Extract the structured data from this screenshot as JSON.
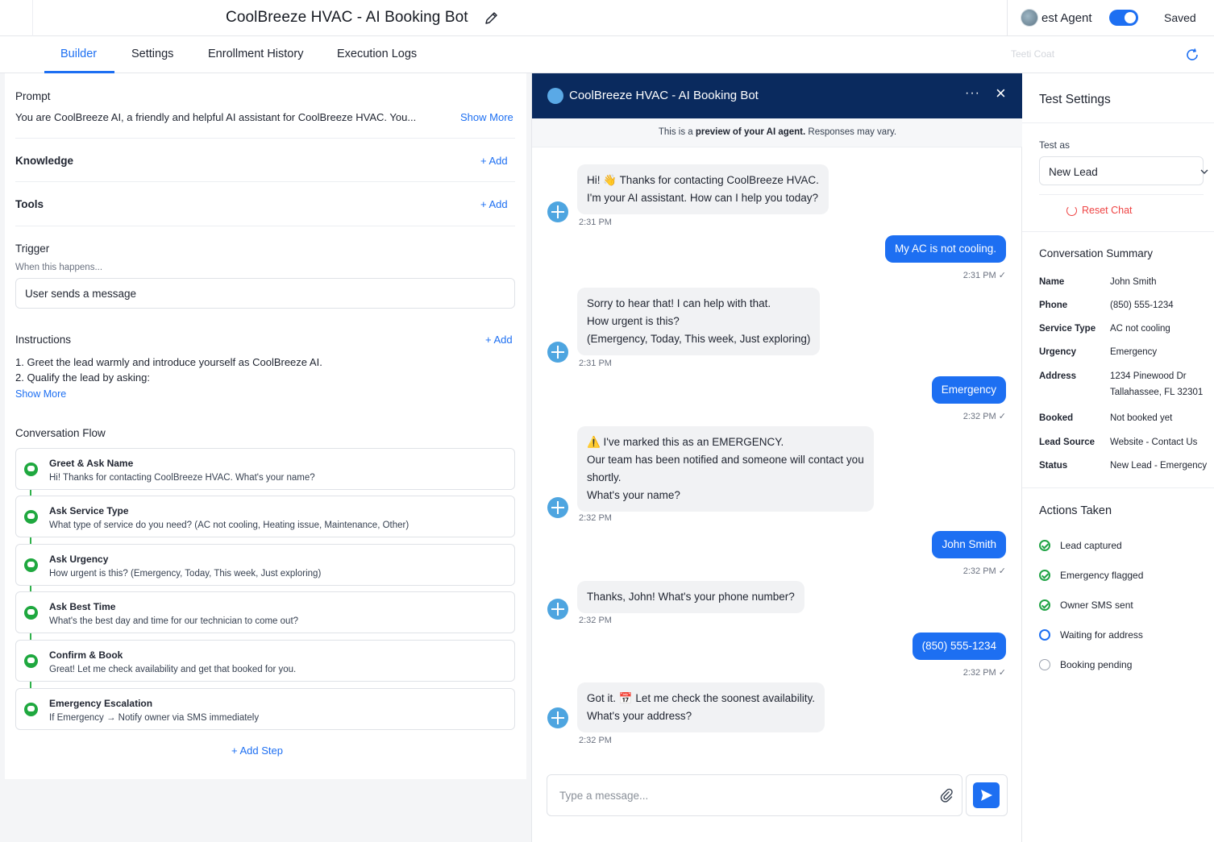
{
  "header": {
    "title": "CoolBreeze HVAC - AI Booking Bot",
    "agent_label": "est Agent",
    "saved": "Saved"
  },
  "tabs": [
    {
      "label": "Builder"
    },
    {
      "label": "Settings"
    },
    {
      "label": "Enrollment History"
    },
    {
      "label": "Execution Logs"
    }
  ],
  "tabbar_ghost": "Teeti Coat",
  "builder": {
    "prompt_label": "Prompt",
    "prompt_text": "You are CoolBreeze AI, a friendly and helpful AI assistant for CoolBreeze HVAC. You...",
    "show_more": "Show More",
    "knowledge_label": "Knowledge",
    "tools_label": "Tools",
    "add": "+ Add",
    "trigger_label": "Trigger",
    "trigger_sub": "When this happens...",
    "trigger_value": "User sends a message",
    "instructions_label": "Instructions",
    "instructions": [
      "1. Greet the lead warmly and introduce yourself as CoolBreeze AI.",
      "2. Qualify the lead by asking:"
    ],
    "instructions_show_more": "Show More",
    "flow_label": "Conversation Flow",
    "steps": [
      {
        "title": "Greet & Ask Name",
        "desc": "Hi! Thanks for contacting CoolBreeze HVAC. What's your name?"
      },
      {
        "title": "Ask Service Type",
        "desc": "What type of service do you need? (AC not cooling, Heating issue, Maintenance, Other)"
      },
      {
        "title": "Ask Urgency",
        "desc": "How urgent is this? (Emergency, Today, This week, Just exploring)"
      },
      {
        "title": "Ask Best Time",
        "desc": "What's the best day and time for our technician to come out?"
      },
      {
        "title": "Confirm & Book",
        "desc": "Great! Let me check availability and get that booked for you."
      },
      {
        "title": "Emergency Escalation",
        "desc": "If Emergency → Notify owner via SMS immediately"
      }
    ],
    "add_step": "+ Add Step"
  },
  "chat": {
    "title": "CoolBreeze HVAC - AI Booking Bot",
    "more": "···",
    "close": "×",
    "preview_pre": "This is a ",
    "preview_bold": "preview of your AI agent.",
    "preview_post": " Responses may vary.",
    "messages": [
      {
        "from": "bot",
        "lines": [
          "Hi! 👋 Thanks for contacting CoolBreeze HVAC.",
          "I'm your AI assistant. How can I help you today?"
        ],
        "time": "2:31 PM"
      },
      {
        "from": "user",
        "text": "My AC is not cooling.",
        "time": "2:31 PM ✓"
      },
      {
        "from": "bot",
        "lines": [
          "Sorry to hear that! I can help with that.",
          "How urgent is this?",
          "(Emergency, Today, This week, Just exploring)"
        ],
        "time": "2:31 PM"
      },
      {
        "from": "user",
        "text": "Emergency",
        "time": "2:32 PM ✓"
      },
      {
        "from": "bot",
        "lines": [
          "⚠️ I've marked this as an EMERGENCY.",
          "Our team has been notified and someone will contact you",
          "shortly.",
          "What's your name?"
        ],
        "time": "2:32 PM"
      },
      {
        "from": "user",
        "text": "John Smith",
        "time": "2:32 PM ✓"
      },
      {
        "from": "bot",
        "lines": [
          "Thanks, John! What's your phone number?"
        ],
        "time": "2:32 PM"
      },
      {
        "from": "user",
        "text": "(850) 555-1234",
        "time": "2:32 PM ✓"
      },
      {
        "from": "bot",
        "lines": [
          "Got it. 📅 Let me check the soonest availability.",
          "What's your address?"
        ],
        "time": "2:32 PM"
      }
    ],
    "input_placeholder": "Type a message..."
  },
  "test_settings": {
    "title": "Test Settings",
    "test_as_label": "Test as",
    "test_as_value": "New Lead",
    "reset_chat": "Reset Chat",
    "summary_title": "Conversation Summary",
    "summary": [
      {
        "k": "Name",
        "v": "John Smith"
      },
      {
        "k": "Phone",
        "v": "(850) 555-1234"
      },
      {
        "k": "Service Type",
        "v": "AC not cooling"
      },
      {
        "k": "Urgency",
        "v": "Emergency"
      },
      {
        "k": "Address",
        "v": "1234 Pinewood Dr",
        "v2": "Tallahassee, FL 32301"
      },
      {
        "k": "Booked",
        "v": "Not booked yet"
      },
      {
        "k": "Lead Source",
        "v": "Website - Contact Us"
      },
      {
        "k": "Status",
        "v": "New Lead - Emergency"
      }
    ],
    "actions_title": "Actions Taken",
    "actions": [
      {
        "label": "Lead captured",
        "state": "done"
      },
      {
        "label": "Emergency flagged",
        "state": "done"
      },
      {
        "label": "Owner SMS sent",
        "state": "done"
      },
      {
        "label": "Waiting for address",
        "state": "waiting"
      },
      {
        "label": "Booking pending",
        "state": "pending"
      }
    ]
  },
  "colors": {
    "accent": "#1d6ff2",
    "chat_header": "#0a2a5e",
    "success": "#22a447",
    "danger": "#ef4444"
  }
}
